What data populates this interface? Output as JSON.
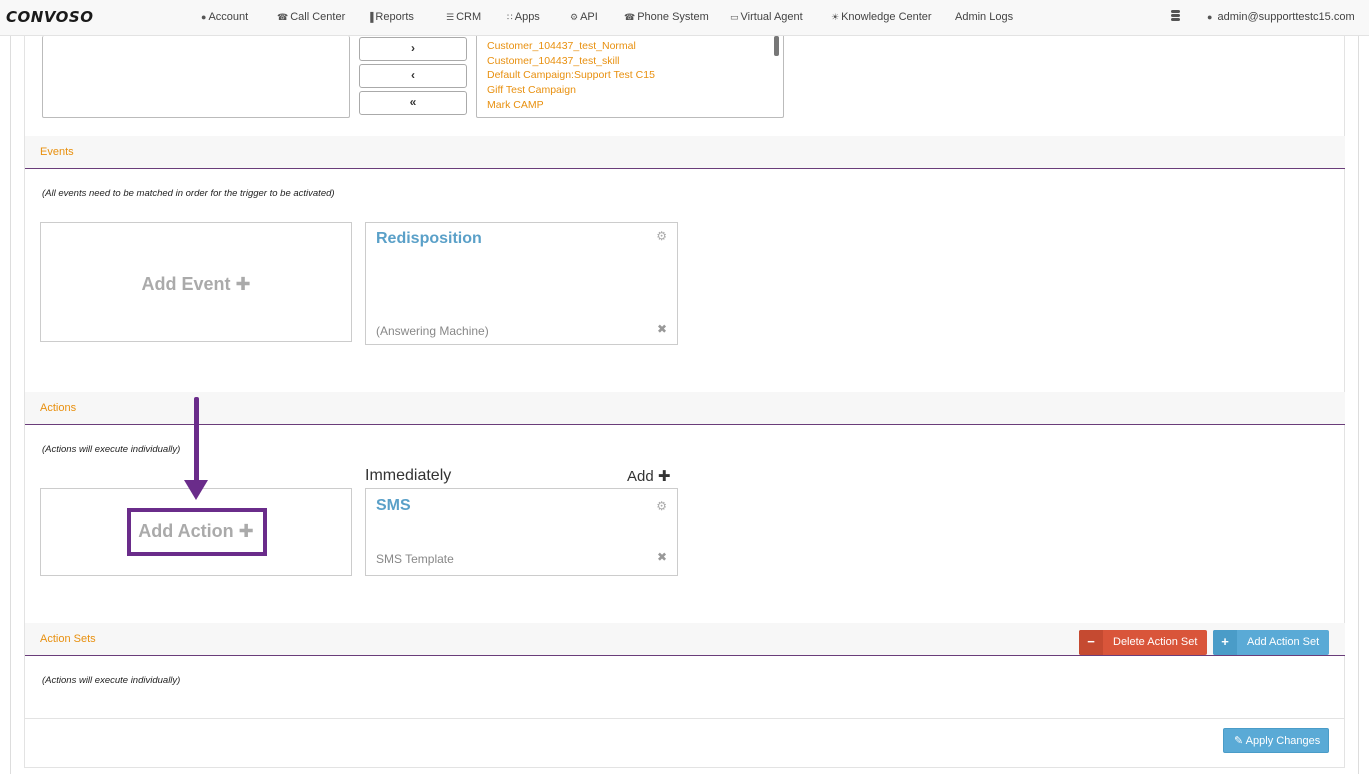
{
  "brand": {
    "logo_text": "CONVOSO"
  },
  "nav": {
    "items": [
      {
        "label": "Account",
        "icon": "user-icon",
        "glyph": "●"
      },
      {
        "label": "Call Center",
        "icon": "phone-icon",
        "glyph": "☎"
      },
      {
        "label": "Reports",
        "icon": "bar-chart-icon",
        "glyph": "▐"
      },
      {
        "label": "CRM",
        "icon": "list-icon",
        "glyph": "☰"
      },
      {
        "label": "Apps",
        "icon": "grid-icon",
        "glyph": "∷"
      },
      {
        "label": "API",
        "icon": "gear-icon",
        "glyph": "⚙"
      },
      {
        "label": "Phone System",
        "icon": "phone-icon",
        "glyph": "☎"
      },
      {
        "label": "Virtual Agent",
        "icon": "monitor-icon",
        "glyph": "▭"
      },
      {
        "label": "Knowledge Center",
        "icon": "lightbulb-icon",
        "glyph": "☀"
      },
      {
        "label": "Admin Logs",
        "icon": "",
        "glyph": ""
      }
    ],
    "user": {
      "label": "admin@supporttestc15.com",
      "icon": "user-icon",
      "glyph": "●"
    }
  },
  "campaigns": {
    "move_buttons": [
      "›",
      "‹",
      "«"
    ],
    "selected": [
      "Customer_104437_test_Normal",
      "Customer_104437_test_skill",
      "Default Campaign:Support Test C15",
      "Giff Test Campaign",
      "Mark CAMP"
    ]
  },
  "events": {
    "title": "Events",
    "hint": "(All events need to be matched in order for the trigger to be activated)",
    "add_label": "Add Event ✚",
    "card": {
      "title": "Redisposition",
      "subtitle": "(Answering Machine)"
    }
  },
  "actions": {
    "title": "Actions",
    "hint": "(Actions will execute individually)",
    "add_label": "Add Action ✚",
    "timing_label": "Immediately",
    "add_link": "Add ✚",
    "card": {
      "title": "SMS",
      "subtitle": "SMS Template"
    }
  },
  "action_sets": {
    "title": "Action Sets",
    "hint": "(Actions will execute individually)",
    "delete_label": "Delete Action Set",
    "add_label": "Add Action Set"
  },
  "footer": {
    "apply_label": "Apply Changes"
  },
  "colors": {
    "accent_orange": "#e8900f",
    "link_blue": "#5aa0c8",
    "annotation_purple": "#6a2c8a",
    "danger": "#d9553a",
    "info": "#5aaad6"
  }
}
